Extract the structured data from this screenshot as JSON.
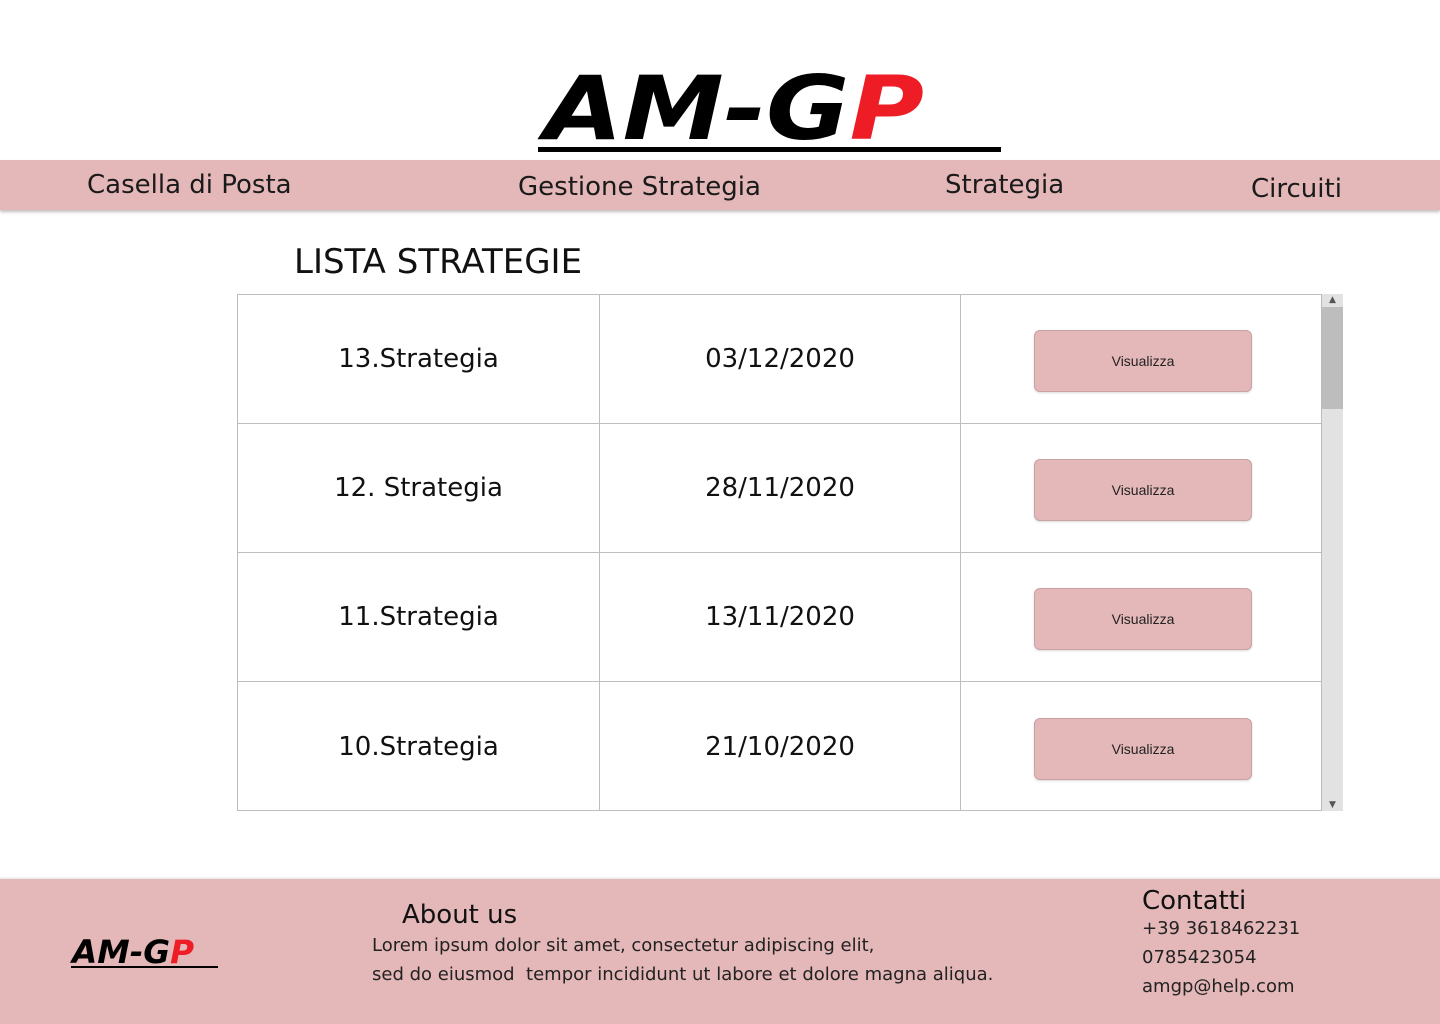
{
  "logo": {
    "text_black": "AM-G",
    "text_red": "P"
  },
  "nav": {
    "items": [
      {
        "label": "Casella di Posta"
      },
      {
        "label": "Gestione Strategia"
      },
      {
        "label": "Strategia"
      },
      {
        "label": "Circuiti"
      }
    ]
  },
  "main": {
    "title": "LISTA STRATEGIE",
    "rows": [
      {
        "name": "13.Strategia",
        "date": "03/12/2020",
        "action": "Visualizza"
      },
      {
        "name": "12. Strategia",
        "date": "28/11/2020",
        "action": "Visualizza"
      },
      {
        "name": "11.Strategia",
        "date": "13/11/2020",
        "action": "Visualizza"
      },
      {
        "name": "10.Strategia",
        "date": "21/10/2020",
        "action": "Visualizza"
      }
    ]
  },
  "footer": {
    "about_title": "About us",
    "about_line1": "Lorem ipsum dolor sit amet, consectetur adipiscing elit,",
    "about_line2": "sed do eiusmod  tempor incididunt ut labore et dolore magna aliqua.",
    "contact_title": "Contatti",
    "phone1": "+39 3618462231",
    "phone2": "0785423054",
    "email": "amgp@help.com"
  },
  "colors": {
    "accent_pink": "#e4b7b8",
    "logo_red": "#ee1c25",
    "logo_black": "#000000"
  }
}
